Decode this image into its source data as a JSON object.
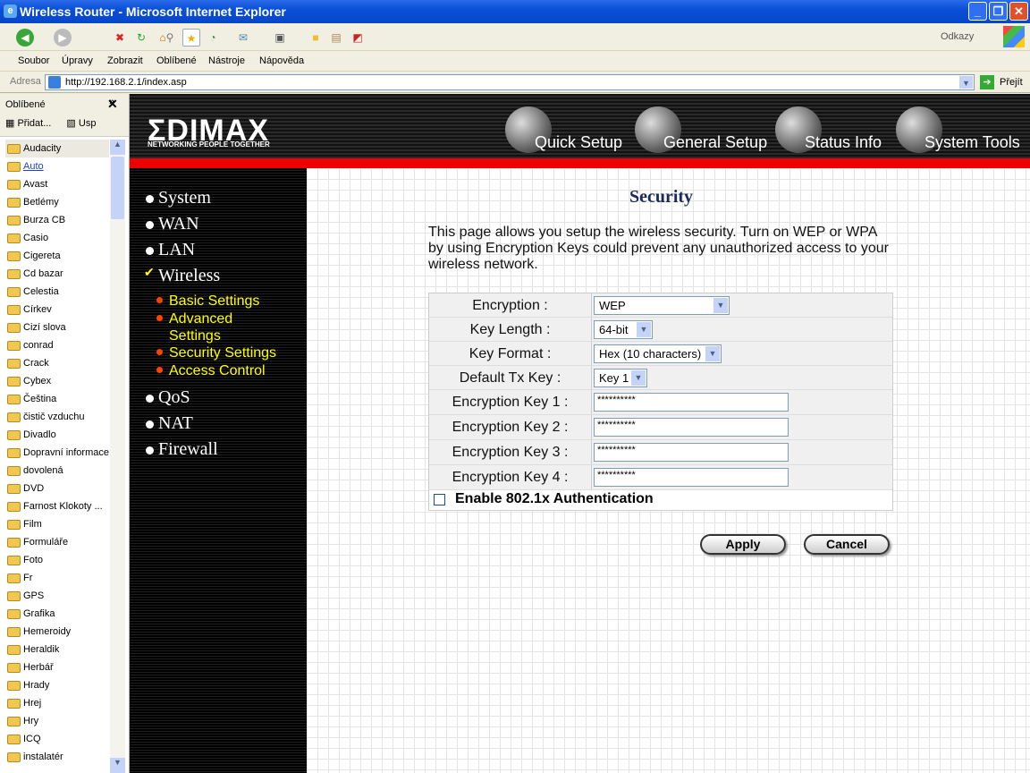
{
  "window": {
    "title": "Wireless Router - Microsoft Internet Explorer"
  },
  "toolbar": {
    "links_label": "Odkazy"
  },
  "menu": [
    "Soubor",
    "Úpravy",
    "Zobrazit",
    "Oblíbené",
    "Nástroje",
    "Nápověda"
  ],
  "address": {
    "label": "Adresa",
    "url": "http://192.168.2.1/index.asp",
    "go": "Přejít"
  },
  "favorites": {
    "title": "Oblíbené",
    "add": "Přidat...",
    "organize": "Usp",
    "items": [
      "Audacity",
      "Auto",
      "Avast",
      "Betlémy",
      "Burza CB",
      "Casio",
      "Cigereta",
      "Cd bazar",
      "Celestia",
      "Církev",
      "Cizí slova",
      "conrad",
      "Crack",
      "Cybex",
      "Čeština",
      "čistič vzduchu",
      "Divadlo",
      "Dopravní informace",
      "dovolená",
      "DVD",
      "Farnost Klokoty ...",
      "Film",
      "Formuláře",
      "Foto",
      "Fr",
      "GPS",
      "Grafika",
      "Hemeroidy",
      "Heraldik",
      "Herbář",
      "Hrady",
      "Hrej",
      "Hry",
      "ICQ",
      "instalatér"
    ]
  },
  "router": {
    "logo": "ΣDIMAX",
    "tagline": "NETWORKING PEOPLE TOGETHER",
    "top_nav": [
      "Quick Setup",
      "General Setup",
      "Status Info",
      "System Tools"
    ],
    "nav": [
      "System",
      "WAN",
      "LAN",
      "Wireless",
      "QoS",
      "NAT",
      "Firewall"
    ],
    "subnav": [
      "Basic Settings",
      "Advanced Settings",
      "Security Settings",
      "Access Control"
    ],
    "page_title": "Security",
    "description": "This page allows you setup the wireless security. Turn on WEP or WPA by using Encryption Keys could prevent any unauthorized access to your wireless network.",
    "fields": {
      "encryption_label": "Encryption :",
      "encryption_value": "WEP",
      "key_length_label": "Key Length :",
      "key_length_value": "64-bit",
      "key_format_label": "Key Format :",
      "key_format_value": "Hex (10 characters)",
      "default_tx_label": "Default Tx Key :",
      "default_tx_value": "Key 1",
      "keys": [
        {
          "label": "Encryption Key 1 :",
          "value": "**********"
        },
        {
          "label": "Encryption Key 2 :",
          "value": "**********"
        },
        {
          "label": "Encryption Key 3 :",
          "value": "**********"
        },
        {
          "label": "Encryption Key 4 :",
          "value": "**********"
        }
      ],
      "enable_8021x": "Enable 802.1x Authentication",
      "enable_8021x_checked": false
    },
    "apply": "Apply",
    "cancel": "Cancel"
  },
  "colors": {
    "titlebar": "#0a4fd6",
    "red_bar": "#ee0000",
    "submenu": "#ffff00",
    "title": "#1a2a5a"
  }
}
